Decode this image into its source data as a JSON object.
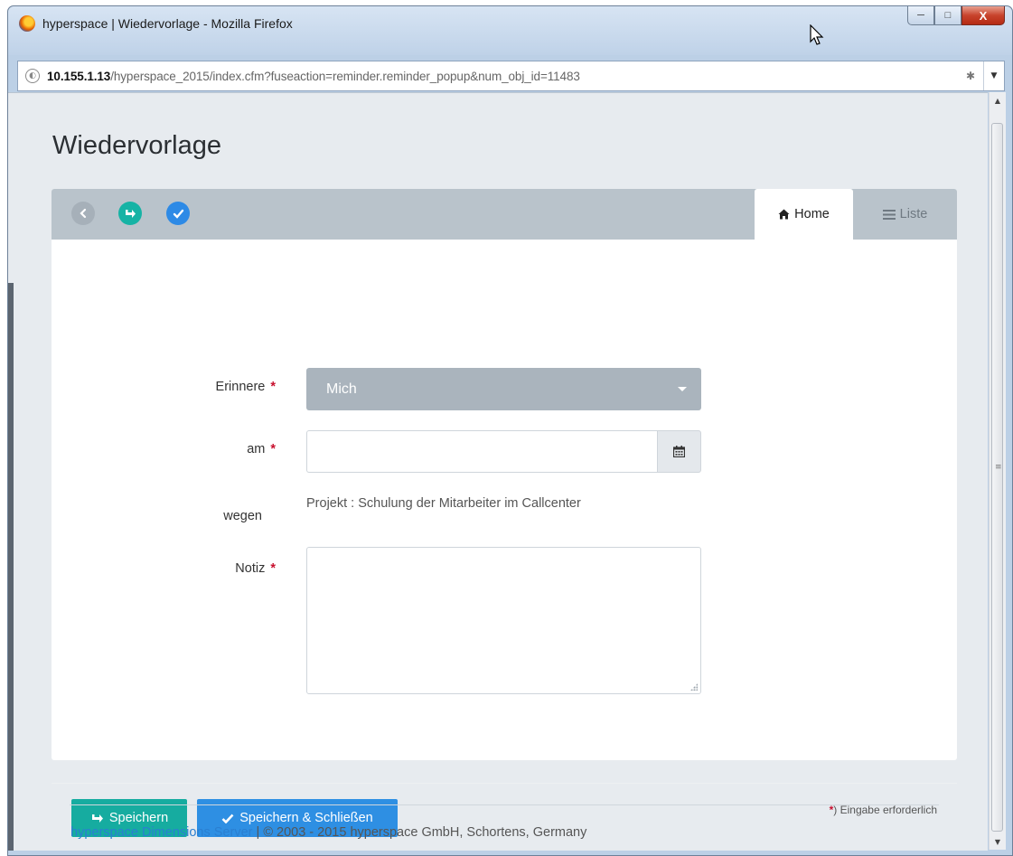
{
  "window": {
    "title": "hyperspace | Wiedervorlage - Mozilla Firefox",
    "minimize_label": "─",
    "maximize_label": "□",
    "close_label": "X"
  },
  "urlbar": {
    "host": "10.155.1.13",
    "path": "/hyperspace_2015/index.cfm?fuseaction=reminder.reminder_popup&num_obj_id=11483"
  },
  "page": {
    "title": "Wiedervorlage"
  },
  "toolbar": {
    "icons": [
      "back-icon",
      "share-save-icon",
      "check-icon"
    ]
  },
  "tabs": [
    {
      "label": "Home",
      "icon": "home-icon",
      "active": true
    },
    {
      "label": "Liste",
      "icon": "list-icon",
      "active": false
    }
  ],
  "form": {
    "erinnere": {
      "label": "Erinnere",
      "required_mark": "*",
      "value": "Mich"
    },
    "am": {
      "label": "am",
      "required_mark": "*",
      "value": "",
      "icon": "calendar-icon"
    },
    "wegen": {
      "label": "wegen",
      "value": "Projekt : Schulung der Mitarbeiter im Callcenter"
    },
    "notiz": {
      "label": "Notiz",
      "required_mark": "*",
      "value": ""
    }
  },
  "actions": {
    "save_label": "Speichern",
    "save_close_label": "Speichern & Schließen"
  },
  "required_note": {
    "star": "*",
    "text": ") Eingabe erforderlich"
  },
  "footer": {
    "link_text": "hyperspace Dimensions Server",
    "separator": " | ",
    "copyright": "© 2003 - 2015 hyperspace GmbH, Schortens, Germany"
  },
  "colors": {
    "teal": "#16aca0",
    "blue": "#2e8fe3",
    "required_red": "#c8102e"
  }
}
